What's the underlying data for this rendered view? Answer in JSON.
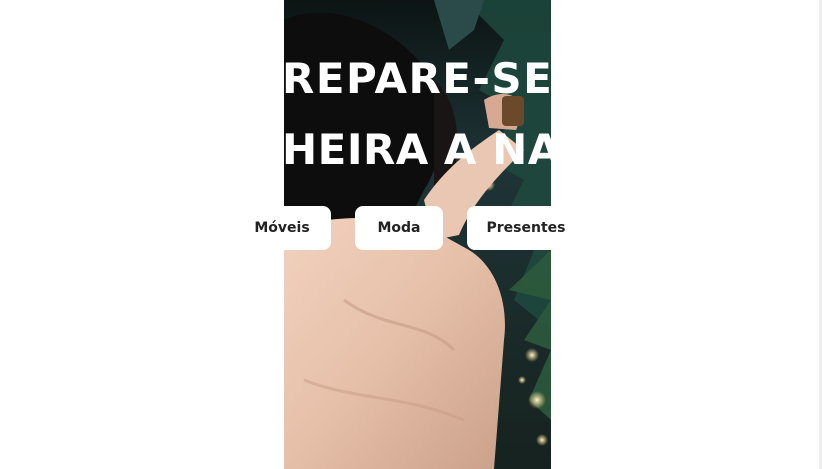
{
  "hero": {
    "headline_line1": "REPARE-SE",
    "headline_line2": "HEIRA A NA",
    "image_description_icon": "woman-decorating-christmas-tree-photo"
  },
  "categories": [
    {
      "label": "Móveis"
    },
    {
      "label": "Moda"
    },
    {
      "label": "Presentes"
    }
  ],
  "colors": {
    "background": "#ffffff",
    "headline": "#ffffff",
    "pill_background": "#ffffff",
    "pill_text": "#222222"
  }
}
